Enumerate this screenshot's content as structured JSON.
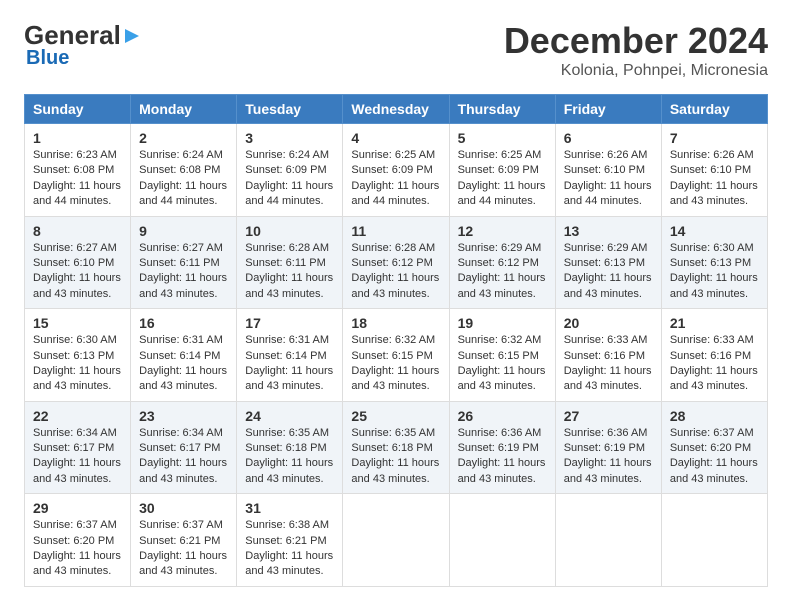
{
  "header": {
    "logo_line1": "General",
    "logo_line2": "Blue",
    "title": "December 2024",
    "subtitle": "Kolonia, Pohnpei, Micronesia"
  },
  "weekdays": [
    "Sunday",
    "Monday",
    "Tuesday",
    "Wednesday",
    "Thursday",
    "Friday",
    "Saturday"
  ],
  "weeks": [
    [
      {
        "day": "1",
        "sunrise": "6:23 AM",
        "sunset": "6:08 PM",
        "daylight": "11 hours and 44 minutes."
      },
      {
        "day": "2",
        "sunrise": "6:24 AM",
        "sunset": "6:08 PM",
        "daylight": "11 hours and 44 minutes."
      },
      {
        "day": "3",
        "sunrise": "6:24 AM",
        "sunset": "6:09 PM",
        "daylight": "11 hours and 44 minutes."
      },
      {
        "day": "4",
        "sunrise": "6:25 AM",
        "sunset": "6:09 PM",
        "daylight": "11 hours and 44 minutes."
      },
      {
        "day": "5",
        "sunrise": "6:25 AM",
        "sunset": "6:09 PM",
        "daylight": "11 hours and 44 minutes."
      },
      {
        "day": "6",
        "sunrise": "6:26 AM",
        "sunset": "6:10 PM",
        "daylight": "11 hours and 44 minutes."
      },
      {
        "day": "7",
        "sunrise": "6:26 AM",
        "sunset": "6:10 PM",
        "daylight": "11 hours and 43 minutes."
      }
    ],
    [
      {
        "day": "8",
        "sunrise": "6:27 AM",
        "sunset": "6:10 PM",
        "daylight": "11 hours and 43 minutes."
      },
      {
        "day": "9",
        "sunrise": "6:27 AM",
        "sunset": "6:11 PM",
        "daylight": "11 hours and 43 minutes."
      },
      {
        "day": "10",
        "sunrise": "6:28 AM",
        "sunset": "6:11 PM",
        "daylight": "11 hours and 43 minutes."
      },
      {
        "day": "11",
        "sunrise": "6:28 AM",
        "sunset": "6:12 PM",
        "daylight": "11 hours and 43 minutes."
      },
      {
        "day": "12",
        "sunrise": "6:29 AM",
        "sunset": "6:12 PM",
        "daylight": "11 hours and 43 minutes."
      },
      {
        "day": "13",
        "sunrise": "6:29 AM",
        "sunset": "6:13 PM",
        "daylight": "11 hours and 43 minutes."
      },
      {
        "day": "14",
        "sunrise": "6:30 AM",
        "sunset": "6:13 PM",
        "daylight": "11 hours and 43 minutes."
      }
    ],
    [
      {
        "day": "15",
        "sunrise": "6:30 AM",
        "sunset": "6:13 PM",
        "daylight": "11 hours and 43 minutes."
      },
      {
        "day": "16",
        "sunrise": "6:31 AM",
        "sunset": "6:14 PM",
        "daylight": "11 hours and 43 minutes."
      },
      {
        "day": "17",
        "sunrise": "6:31 AM",
        "sunset": "6:14 PM",
        "daylight": "11 hours and 43 minutes."
      },
      {
        "day": "18",
        "sunrise": "6:32 AM",
        "sunset": "6:15 PM",
        "daylight": "11 hours and 43 minutes."
      },
      {
        "day": "19",
        "sunrise": "6:32 AM",
        "sunset": "6:15 PM",
        "daylight": "11 hours and 43 minutes."
      },
      {
        "day": "20",
        "sunrise": "6:33 AM",
        "sunset": "6:16 PM",
        "daylight": "11 hours and 43 minutes."
      },
      {
        "day": "21",
        "sunrise": "6:33 AM",
        "sunset": "6:16 PM",
        "daylight": "11 hours and 43 minutes."
      }
    ],
    [
      {
        "day": "22",
        "sunrise": "6:34 AM",
        "sunset": "6:17 PM",
        "daylight": "11 hours and 43 minutes."
      },
      {
        "day": "23",
        "sunrise": "6:34 AM",
        "sunset": "6:17 PM",
        "daylight": "11 hours and 43 minutes."
      },
      {
        "day": "24",
        "sunrise": "6:35 AM",
        "sunset": "6:18 PM",
        "daylight": "11 hours and 43 minutes."
      },
      {
        "day": "25",
        "sunrise": "6:35 AM",
        "sunset": "6:18 PM",
        "daylight": "11 hours and 43 minutes."
      },
      {
        "day": "26",
        "sunrise": "6:36 AM",
        "sunset": "6:19 PM",
        "daylight": "11 hours and 43 minutes."
      },
      {
        "day": "27",
        "sunrise": "6:36 AM",
        "sunset": "6:19 PM",
        "daylight": "11 hours and 43 minutes."
      },
      {
        "day": "28",
        "sunrise": "6:37 AM",
        "sunset": "6:20 PM",
        "daylight": "11 hours and 43 minutes."
      }
    ],
    [
      {
        "day": "29",
        "sunrise": "6:37 AM",
        "sunset": "6:20 PM",
        "daylight": "11 hours and 43 minutes."
      },
      {
        "day": "30",
        "sunrise": "6:37 AM",
        "sunset": "6:21 PM",
        "daylight": "11 hours and 43 minutes."
      },
      {
        "day": "31",
        "sunrise": "6:38 AM",
        "sunset": "6:21 PM",
        "daylight": "11 hours and 43 minutes."
      },
      null,
      null,
      null,
      null
    ]
  ]
}
